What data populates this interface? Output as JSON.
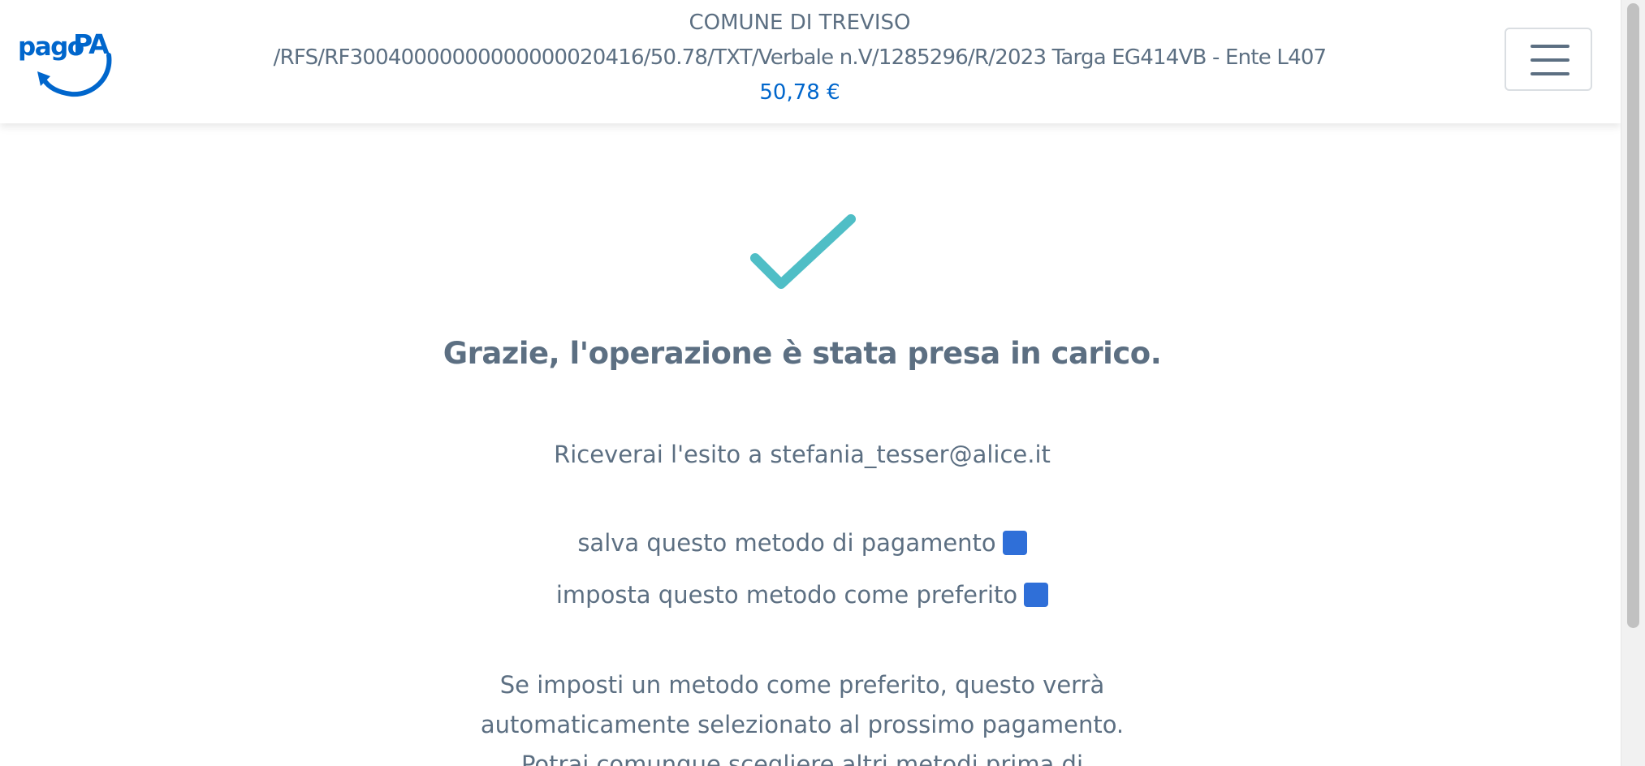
{
  "header": {
    "logo_text": "pagoPA",
    "ente": "COMUNE DI TREVISO",
    "subject": "/RFS/RF30040000000000000020416/50.78/TXT/Verbale n.V/1285296/R/2023 Targa EG414VB - Ente L407",
    "amount": "50,78 €",
    "menu_icon": "hamburger-menu-icon"
  },
  "content": {
    "status_icon": "check-icon",
    "title": "Grazie, l'operazione è stata presa in carico.",
    "result_text": "Riceverai l'esito a stefania_tesser@alice.it",
    "options": [
      {
        "label": "salva questo metodo di pagamento",
        "checked": true
      },
      {
        "label": "imposta questo metodo come preferito",
        "checked": true
      }
    ],
    "info_lines": [
      "Se imposti un metodo come preferito, questo verrà",
      "automaticamente selezionato al prossimo pagamento.",
      "Potrai comunque scegliere altri metodi prima di"
    ]
  },
  "colors": {
    "brand_blue": "#0066cc",
    "checkbox_blue": "#2f6fd8",
    "check_teal": "#4fbec6",
    "text_grey": "#5c6f82"
  }
}
